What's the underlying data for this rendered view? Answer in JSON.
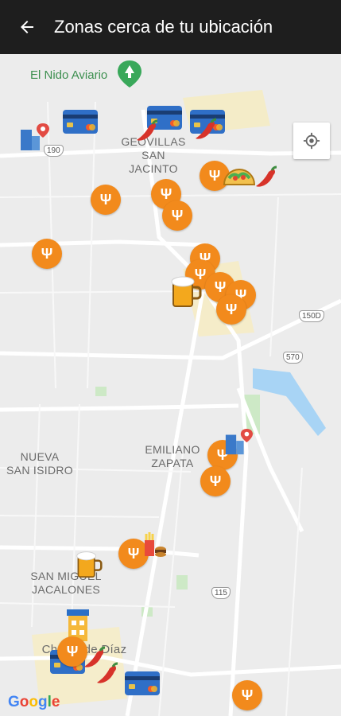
{
  "header": {
    "title": "Zonas cerca de tu ubicación",
    "back_icon": "arrow-left-icon"
  },
  "map": {
    "landmark": "El Nido Aviario",
    "areas": [
      {
        "name": "GEOVILLAS",
        "sub": "SAN JACINTO"
      },
      {
        "name": "EMILIANO",
        "sub": "ZAPATA"
      },
      {
        "name": "NUEVA",
        "sub": "SAN ISIDRO"
      },
      {
        "name": "SAN MIGUEL",
        "sub": "JACALONES"
      }
    ],
    "town": "Chalco de Díaz",
    "roads": [
      "190",
      "150D",
      "570",
      "115"
    ],
    "attribution": "Google",
    "locate_icon": "my-location-icon",
    "colors": {
      "food_marker": "#f28a1c",
      "water": "#a8d4f5",
      "park": "#cde9c6",
      "appbar": "#1e1e1e"
    }
  }
}
